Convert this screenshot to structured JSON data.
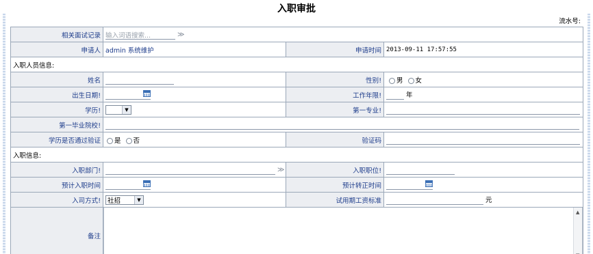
{
  "page": {
    "title": "入职审批",
    "serial_label": "流水号:"
  },
  "rows": {
    "interview_record": {
      "label": "相关面试记录",
      "placeholder": "输入词语搜索...",
      "search_glyph": "≫"
    },
    "applicant": {
      "label": "申请人",
      "value": "admin 系统维护"
    },
    "apply_time": {
      "label": "申请时间",
      "value": "2013-09-11 17:57:55"
    },
    "section_personal": "入职人员信息:",
    "name": {
      "label": "姓名"
    },
    "gender": {
      "label": "性别",
      "req": "!",
      "option_male": "男",
      "option_female": "女"
    },
    "birth_date": {
      "label": "出生日期",
      "req": "!"
    },
    "work_years": {
      "label": "工作年限",
      "req": "!",
      "unit": "年"
    },
    "education": {
      "label": "学历",
      "req": "!",
      "selected": ""
    },
    "major": {
      "label": "第一专业",
      "req": "!"
    },
    "graduate_school": {
      "label": "第一毕业院校",
      "req": "!"
    },
    "edu_verified": {
      "label": "学历是否通过验证",
      "option_yes": "是",
      "option_no": "否"
    },
    "verify_code": {
      "label": "验证码"
    },
    "section_entry": "入职信息:",
    "department": {
      "label": "入职部门",
      "req": "!",
      "chevron": "≫"
    },
    "position": {
      "label": "入职职位",
      "req": "!"
    },
    "planned_entry_time": {
      "label": "预计入职时间"
    },
    "planned_regular_time": {
      "label": "预计转正时间"
    },
    "entry_method": {
      "label": "入司方式",
      "req": "!",
      "selected": "社招"
    },
    "probation_salary": {
      "label": "试用期工资标准",
      "unit": "元"
    },
    "remarks": {
      "label": "备注"
    }
  }
}
